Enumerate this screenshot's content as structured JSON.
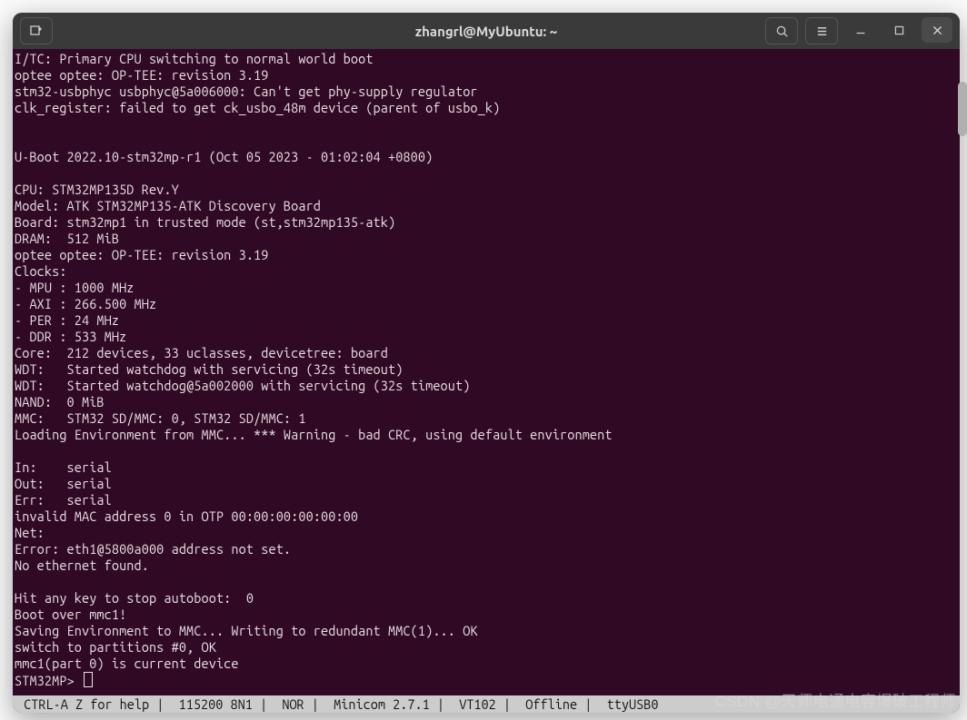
{
  "titlebar": {
    "title": "zhangrl@MyUbuntu: ~",
    "icons": {
      "new_tab": "new-tab-icon",
      "search": "search-icon",
      "menu": "hamburger-icon",
      "minimize": "minimize-icon",
      "maximize": "maximize-icon",
      "close": "close-icon"
    }
  },
  "terminal_lines": [
    "I/TC: Primary CPU switching to normal world boot",
    "optee optee: OP-TEE: revision 3.19",
    "stm32-usbphyc usbphyc@5a006000: Can't get phy-supply regulator",
    "clk_register: failed to get ck_usbo_48m device (parent of usbo_k)",
    "",
    "",
    "U-Boot 2022.10-stm32mp-r1 (Oct 05 2023 - 01:02:04 +0800)",
    "",
    "CPU: STM32MP135D Rev.Y",
    "Model: ATK STM32MP135-ATK Discovery Board",
    "Board: stm32mp1 in trusted mode (st,stm32mp135-atk)",
    "DRAM:  512 MiB",
    "optee optee: OP-TEE: revision 3.19",
    "Clocks:",
    "- MPU : 1000 MHz",
    "- AXI : 266.500 MHz",
    "- PER : 24 MHz",
    "- DDR : 533 MHz",
    "Core:  212 devices, 33 uclasses, devicetree: board",
    "WDT:   Started watchdog with servicing (32s timeout)",
    "WDT:   Started watchdog@5a002000 with servicing (32s timeout)",
    "NAND:  0 MiB",
    "MMC:   STM32 SD/MMC: 0, STM32 SD/MMC: 1",
    "Loading Environment from MMC... *** Warning - bad CRC, using default environment",
    "",
    "In:    serial",
    "Out:   serial",
    "Err:   serial",
    "invalid MAC address 0 in OTP 00:00:00:00:00:00",
    "Net:",
    "Error: eth1@5800a000 address not set.",
    "No ethernet found.",
    "",
    "Hit any key to stop autoboot:  0",
    "Boot over mmc1!",
    "Saving Environment to MMC... Writing to redundant MMC(1)... OK",
    "switch to partitions #0, OK",
    "mmc1(part 0) is current device"
  ],
  "prompt": "STM32MP> ",
  "statusbar": " CTRL-A Z for help |  115200 8N1 |  NOR |  Minicom 2.7.1 |  VT102 |  Offline |  ttyUSB0",
  "watermark": "CSDN @天师电通电容爆破工程师"
}
